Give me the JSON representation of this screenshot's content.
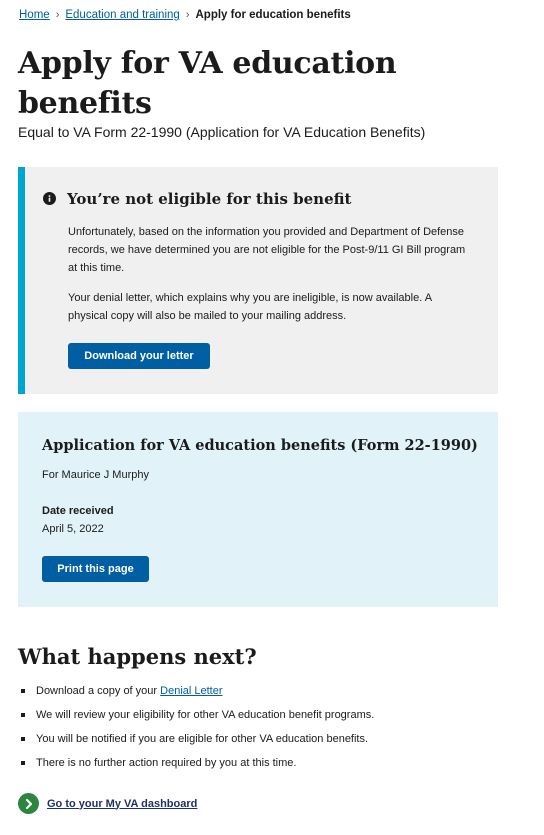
{
  "breadcrumb": {
    "home": "Home",
    "education": "Education and training",
    "current": "Apply for education benefits"
  },
  "page": {
    "title": "Apply for VA education benefits",
    "subtitle": "Equal to VA Form 22-1990 (Application for VA Education Benefits)"
  },
  "alert": {
    "heading": "You’re not eligible for this benefit",
    "paragraph1": "Unfortunately, based on the information you provided and Department of Defense records, we have determined you are not eligible for the Post-9/11 GI Bill program at this time.",
    "paragraph2": "Your denial letter, which explains why you are ineligible, is now available. A physical copy will also be mailed to your mailing address.",
    "button": "Download your letter",
    "icon": "info-icon",
    "accent_color": "#00a6d2"
  },
  "summary": {
    "heading": "Application for VA education benefits (Form 22-1990)",
    "for_text": "For Maurice J Murphy",
    "date_label": "Date received",
    "date_value": "April 5, 2022",
    "print_button": "Print this page"
  },
  "next": {
    "title": "What happens next?",
    "item1_prefix": "Download a copy of your ",
    "item1_link": "Denial Letter",
    "item2": "We will review your eligibility for other VA education benefit programs.",
    "item3": "You will be notified if you are eligible for other VA education benefits.",
    "item4": "There is no further action required by you at this time."
  },
  "dashboard_link": {
    "label": "Go to your My VA dashboard",
    "icon": "chevron-right-circle-icon"
  },
  "colors": {
    "primary": "#005ea2",
    "summary_bg": "#e1f3f8",
    "alert_bg": "#f0f0f0",
    "link_icon_bg": "#2e8540"
  }
}
